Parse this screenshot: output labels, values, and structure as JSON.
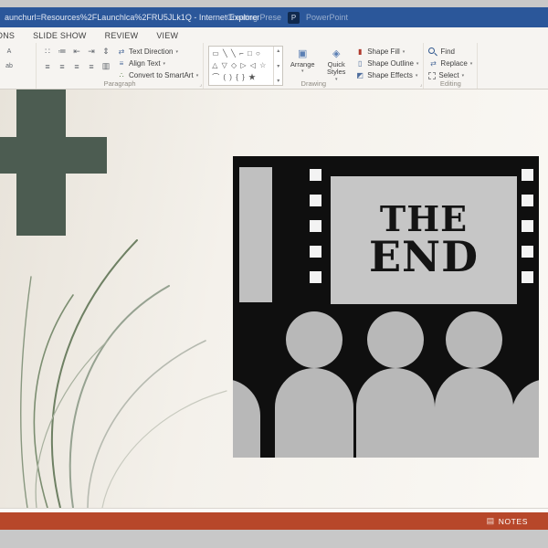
{
  "window": {
    "title": "aunchurl=Resources%2FLaunchlca%2FRU5JLk1Q - Internet Explorer",
    "browser_tab": "Creating Prese",
    "app_name": "PowerPoint"
  },
  "ribbon": {
    "tabs": [
      "ONS",
      "SLIDE SHOW",
      "REVIEW",
      "VIEW"
    ],
    "paragraph": {
      "label": "Paragraph",
      "text_direction": "Text Direction",
      "align_text": "Align Text",
      "convert": "Convert to SmartArt"
    },
    "drawing": {
      "label": "Drawing",
      "arrange": "Arrange",
      "quick_styles": "Quick Styles",
      "shape_fill": "Shape Fill",
      "shape_outline": "Shape Outline",
      "shape_effects": "Shape Effects",
      "shapes_gallery": [
        "▭ ╲ ╲ ⌐ □ ○",
        "△ ▽ ◇ ▷ ◁ ☆",
        "⌒ ( ) { } ★"
      ]
    },
    "editing": {
      "label": "Editing",
      "find": "Find",
      "replace": "Replace",
      "select": "Select"
    }
  },
  "icons": {
    "grow_font": "A",
    "shrink_font": "A",
    "char_a": "A",
    "char_ab": "ab",
    "bullets": "∷",
    "numbering": "≔",
    "indent_less": "⇤",
    "indent_more": "⇥",
    "spacing": "⇕",
    "align_left": "≡",
    "align_center": "≡",
    "align_right": "≡",
    "justify": "≡",
    "columns": "▥",
    "text_direction": "⇄",
    "align_text": "≡",
    "smartart": "∴",
    "arrange": "▣",
    "quick_styles": "◈",
    "shape_fill": "▮",
    "shape_outline": "▯",
    "shape_effects": "◩",
    "replace": "⇄",
    "dropdown": "▾",
    "gallery_up": "▴",
    "gallery_down": "▾",
    "gallery_more": "▾",
    "dialog_launcher": "⌟",
    "notes": "▤",
    "pp_badge": "P"
  },
  "slide": {
    "line1": "THE",
    "line2": "END"
  },
  "statusbar": {
    "notes": "NOTES"
  },
  "colors": {
    "titlebar": "#2b579a",
    "statusbar": "#b7472a",
    "cross": "#4c5c51",
    "clipart_bg": "#0f0f0f",
    "screen": "#c6c6c6",
    "audience": "#b8b8b8"
  }
}
